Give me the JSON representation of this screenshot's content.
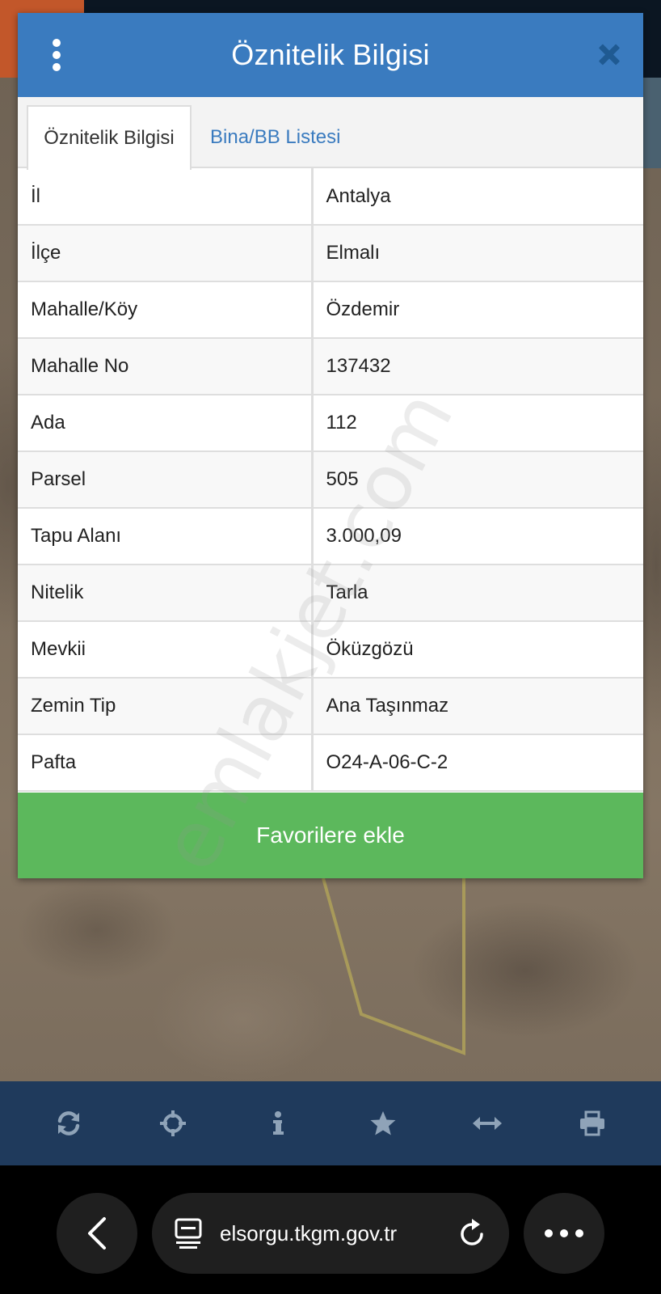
{
  "dialog": {
    "title": "Öznitelik Bilgisi",
    "tabs": [
      {
        "label": "Öznitelik Bilgisi",
        "active": true
      },
      {
        "label": "Bina/BB Listesi",
        "active": false
      }
    ],
    "attributes": [
      {
        "key": "İl",
        "value": "Antalya"
      },
      {
        "key": "İlçe",
        "value": "Elmalı"
      },
      {
        "key": "Mahalle/Köy",
        "value": "Özdemir"
      },
      {
        "key": "Mahalle No",
        "value": "137432"
      },
      {
        "key": "Ada",
        "value": "112"
      },
      {
        "key": "Parsel",
        "value": "505"
      },
      {
        "key": "Tapu Alanı",
        "value": "3.000,09"
      },
      {
        "key": "Nitelik",
        "value": "Tarla"
      },
      {
        "key": "Mevkii",
        "value": "Öküzgözü"
      },
      {
        "key": "Zemin Tip",
        "value": "Ana Taşınmaz"
      },
      {
        "key": "Pafta",
        "value": "O24-A-06-C-2"
      }
    ],
    "favorite_label": "Favorilere ekle"
  },
  "watermark": "emlakjet.com",
  "toolbar": {
    "icons": [
      "refresh-icon",
      "crosshair-icon",
      "info-icon",
      "star-icon",
      "measure-icon",
      "print-icon"
    ]
  },
  "browser": {
    "url": "elsorgu.tkgm.gov.tr"
  },
  "colors": {
    "header": "#3a7bbf",
    "tab_link": "#3a7bbf",
    "favorite_button": "#5cb85c",
    "app_toolbar": "#1f3a5c",
    "toolbar_icon": "#8fa3b8",
    "parcel_line": "#a89a5a"
  }
}
